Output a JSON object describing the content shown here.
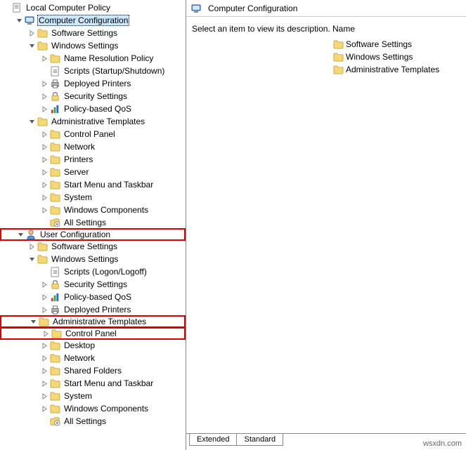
{
  "root_label": "Local Computer Policy",
  "selected_node": "Computer Configuration",
  "right_panel": {
    "title": "Computer Configuration",
    "description_prompt": "Select an item to view its description.",
    "column_header": "Name",
    "items": [
      "Software Settings",
      "Windows Settings",
      "Administrative Templates"
    ]
  },
  "tabs": {
    "extended": "Extended",
    "standard": "Standard"
  },
  "watermark": "wsxdn.com",
  "tree": [
    {
      "depth": 0,
      "exp": "",
      "icon": "policy",
      "label": "Local Computer Policy",
      "hl": false,
      "sel": false
    },
    {
      "depth": 1,
      "exp": "open",
      "icon": "computer",
      "label": "Computer Configuration",
      "hl": false,
      "sel": true
    },
    {
      "depth": 2,
      "exp": "closed",
      "icon": "folder",
      "label": "Software Settings",
      "hl": false,
      "sel": false
    },
    {
      "depth": 2,
      "exp": "open",
      "icon": "folder",
      "label": "Windows Settings",
      "hl": false,
      "sel": false
    },
    {
      "depth": 3,
      "exp": "closed",
      "icon": "folder",
      "label": "Name Resolution Policy",
      "hl": false,
      "sel": false
    },
    {
      "depth": 3,
      "exp": "",
      "icon": "script",
      "label": "Scripts (Startup/Shutdown)",
      "hl": false,
      "sel": false
    },
    {
      "depth": 3,
      "exp": "closed",
      "icon": "printer",
      "label": "Deployed Printers",
      "hl": false,
      "sel": false
    },
    {
      "depth": 3,
      "exp": "closed",
      "icon": "security",
      "label": "Security Settings",
      "hl": false,
      "sel": false
    },
    {
      "depth": 3,
      "exp": "closed",
      "icon": "qos",
      "label": "Policy-based QoS",
      "hl": false,
      "sel": false
    },
    {
      "depth": 2,
      "exp": "open",
      "icon": "folder",
      "label": "Administrative Templates",
      "hl": false,
      "sel": false
    },
    {
      "depth": 3,
      "exp": "closed",
      "icon": "folder",
      "label": "Control Panel",
      "hl": false,
      "sel": false
    },
    {
      "depth": 3,
      "exp": "closed",
      "icon": "folder",
      "label": "Network",
      "hl": false,
      "sel": false
    },
    {
      "depth": 3,
      "exp": "closed",
      "icon": "folder",
      "label": "Printers",
      "hl": false,
      "sel": false
    },
    {
      "depth": 3,
      "exp": "closed",
      "icon": "folder",
      "label": "Server",
      "hl": false,
      "sel": false
    },
    {
      "depth": 3,
      "exp": "closed",
      "icon": "folder",
      "label": "Start Menu and Taskbar",
      "hl": false,
      "sel": false
    },
    {
      "depth": 3,
      "exp": "closed",
      "icon": "folder",
      "label": "System",
      "hl": false,
      "sel": false
    },
    {
      "depth": 3,
      "exp": "closed",
      "icon": "folder",
      "label": "Windows Components",
      "hl": false,
      "sel": false
    },
    {
      "depth": 3,
      "exp": "",
      "icon": "allsettings",
      "label": "All Settings",
      "hl": false,
      "sel": false
    },
    {
      "depth": 1,
      "exp": "open",
      "icon": "user",
      "label": "User Configuration",
      "hl": true,
      "sel": false
    },
    {
      "depth": 2,
      "exp": "closed",
      "icon": "folder",
      "label": "Software Settings",
      "hl": false,
      "sel": false
    },
    {
      "depth": 2,
      "exp": "open",
      "icon": "folder",
      "label": "Windows Settings",
      "hl": false,
      "sel": false
    },
    {
      "depth": 3,
      "exp": "",
      "icon": "script",
      "label": "Scripts (Logon/Logoff)",
      "hl": false,
      "sel": false
    },
    {
      "depth": 3,
      "exp": "closed",
      "icon": "security",
      "label": "Security Settings",
      "hl": false,
      "sel": false
    },
    {
      "depth": 3,
      "exp": "closed",
      "icon": "qos",
      "label": "Policy-based QoS",
      "hl": false,
      "sel": false
    },
    {
      "depth": 3,
      "exp": "closed",
      "icon": "printer",
      "label": "Deployed Printers",
      "hl": false,
      "sel": false
    },
    {
      "depth": 2,
      "exp": "open",
      "icon": "folder",
      "label": "Administrative Templates",
      "hl": true,
      "sel": false
    },
    {
      "depth": 3,
      "exp": "closed",
      "icon": "folder",
      "label": "Control Panel",
      "hl": true,
      "sel": false
    },
    {
      "depth": 3,
      "exp": "closed",
      "icon": "folder",
      "label": "Desktop",
      "hl": false,
      "sel": false
    },
    {
      "depth": 3,
      "exp": "closed",
      "icon": "folder",
      "label": "Network",
      "hl": false,
      "sel": false
    },
    {
      "depth": 3,
      "exp": "closed",
      "icon": "folder",
      "label": "Shared Folders",
      "hl": false,
      "sel": false
    },
    {
      "depth": 3,
      "exp": "closed",
      "icon": "folder",
      "label": "Start Menu and Taskbar",
      "hl": false,
      "sel": false
    },
    {
      "depth": 3,
      "exp": "closed",
      "icon": "folder",
      "label": "System",
      "hl": false,
      "sel": false
    },
    {
      "depth": 3,
      "exp": "closed",
      "icon": "folder",
      "label": "Windows Components",
      "hl": false,
      "sel": false
    },
    {
      "depth": 3,
      "exp": "",
      "icon": "allsettings",
      "label": "All Settings",
      "hl": false,
      "sel": false
    }
  ]
}
